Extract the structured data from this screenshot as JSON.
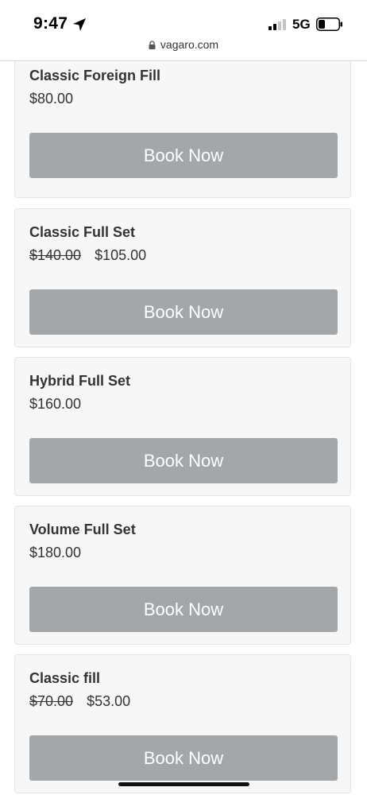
{
  "status_bar": {
    "time": "9:47",
    "network": "5G"
  },
  "browser": {
    "url": "vagaro.com"
  },
  "services": [
    {
      "title": "Classic Foreign Fill",
      "old_price": "",
      "price": "$80.00",
      "button": "Book Now"
    },
    {
      "title": "Classic Full Set",
      "old_price": "$140.00",
      "price": "$105.00",
      "button": "Book Now"
    },
    {
      "title": "Hybrid Full Set",
      "old_price": "",
      "price": "$160.00",
      "button": "Book Now"
    },
    {
      "title": "Volume Full Set",
      "old_price": "",
      "price": "$180.00",
      "button": "Book Now"
    },
    {
      "title": "Classic fill",
      "old_price": "$70.00",
      "price": "$53.00",
      "button": "Book Now"
    }
  ],
  "colors": {
    "button_bg": "#a3a7aa",
    "card_bg": "#f7f7f7"
  }
}
